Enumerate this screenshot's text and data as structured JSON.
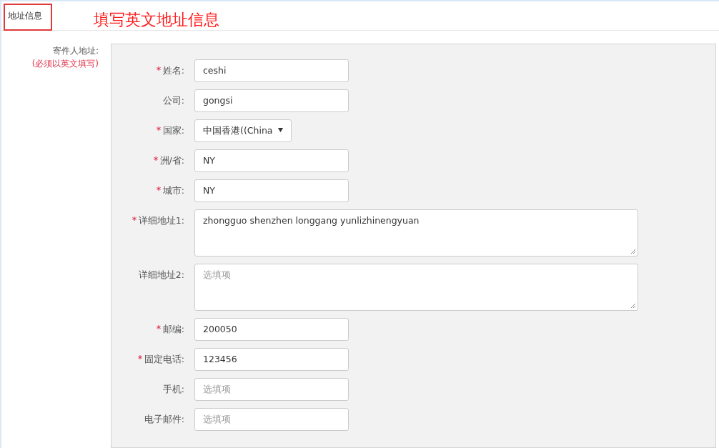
{
  "section_title": "地址信息",
  "annotation": "填写英文地址信息",
  "sender_label": "寄件人地址:",
  "sender_note": "(必须以英文填写)",
  "fields": [
    {
      "label": "姓名:",
      "required": true,
      "kind": "input",
      "value": "ceshi"
    },
    {
      "label": "公司:",
      "required": false,
      "kind": "input",
      "value": "gongsi"
    },
    {
      "label": "国家:",
      "required": true,
      "kind": "select",
      "value": "中国香港((China"
    },
    {
      "label": "洲/省:",
      "required": true,
      "kind": "input",
      "value": "NY"
    },
    {
      "label": "城市:",
      "required": true,
      "kind": "input",
      "value": "NY"
    },
    {
      "label": "详细地址1:",
      "required": true,
      "kind": "textarea",
      "value": "zhongguo shenzhen longgang yunlizhinengyuan"
    },
    {
      "label": "详细地址2:",
      "required": false,
      "kind": "textarea",
      "placeholder": "选填项"
    },
    {
      "label": "邮编:",
      "required": true,
      "kind": "input",
      "value": "200050"
    },
    {
      "label": "固定电话:",
      "required": true,
      "kind": "input",
      "value": "123456"
    },
    {
      "label": "手机:",
      "required": false,
      "kind": "input",
      "placeholder": "选填项"
    },
    {
      "label": "电子邮件:",
      "required": false,
      "kind": "input",
      "placeholder": "选填项"
    }
  ]
}
